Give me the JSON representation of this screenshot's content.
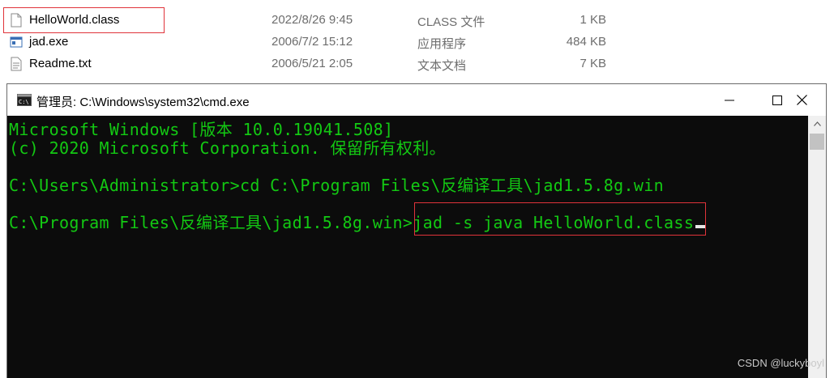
{
  "files": [
    {
      "name": "HelloWorld.class",
      "date": "2022/8/26 9:45",
      "type": "CLASS 文件",
      "size": "1 KB",
      "icon": "document-icon"
    },
    {
      "name": "jad.exe",
      "date": "2006/7/2 15:12",
      "type": "应用程序",
      "size": "484 KB",
      "icon": "application-icon"
    },
    {
      "name": "Readme.txt",
      "date": "2006/5/21 2:05",
      "type": "文本文档",
      "size": "7 KB",
      "icon": "text-file-icon"
    }
  ],
  "cmd": {
    "title": "管理员: C:\\Windows\\system32\\cmd.exe",
    "lines": [
      "Microsoft Windows [版本 10.0.19041.508]",
      "(c) 2020 Microsoft Corporation. 保留所有权利。",
      "",
      "C:\\Users\\Administrator>cd C:\\Program Files\\反编译工具\\jad1.5.8g.win",
      "",
      "C:\\Program Files\\反编译工具\\jad1.5.8g.win>jad -s java HelloWorld.class"
    ],
    "text_color": "#13c913",
    "background_color": "#0c0c0c"
  },
  "highlight_color": "#e0333a",
  "watermark": "CSDN @luckyboyl"
}
